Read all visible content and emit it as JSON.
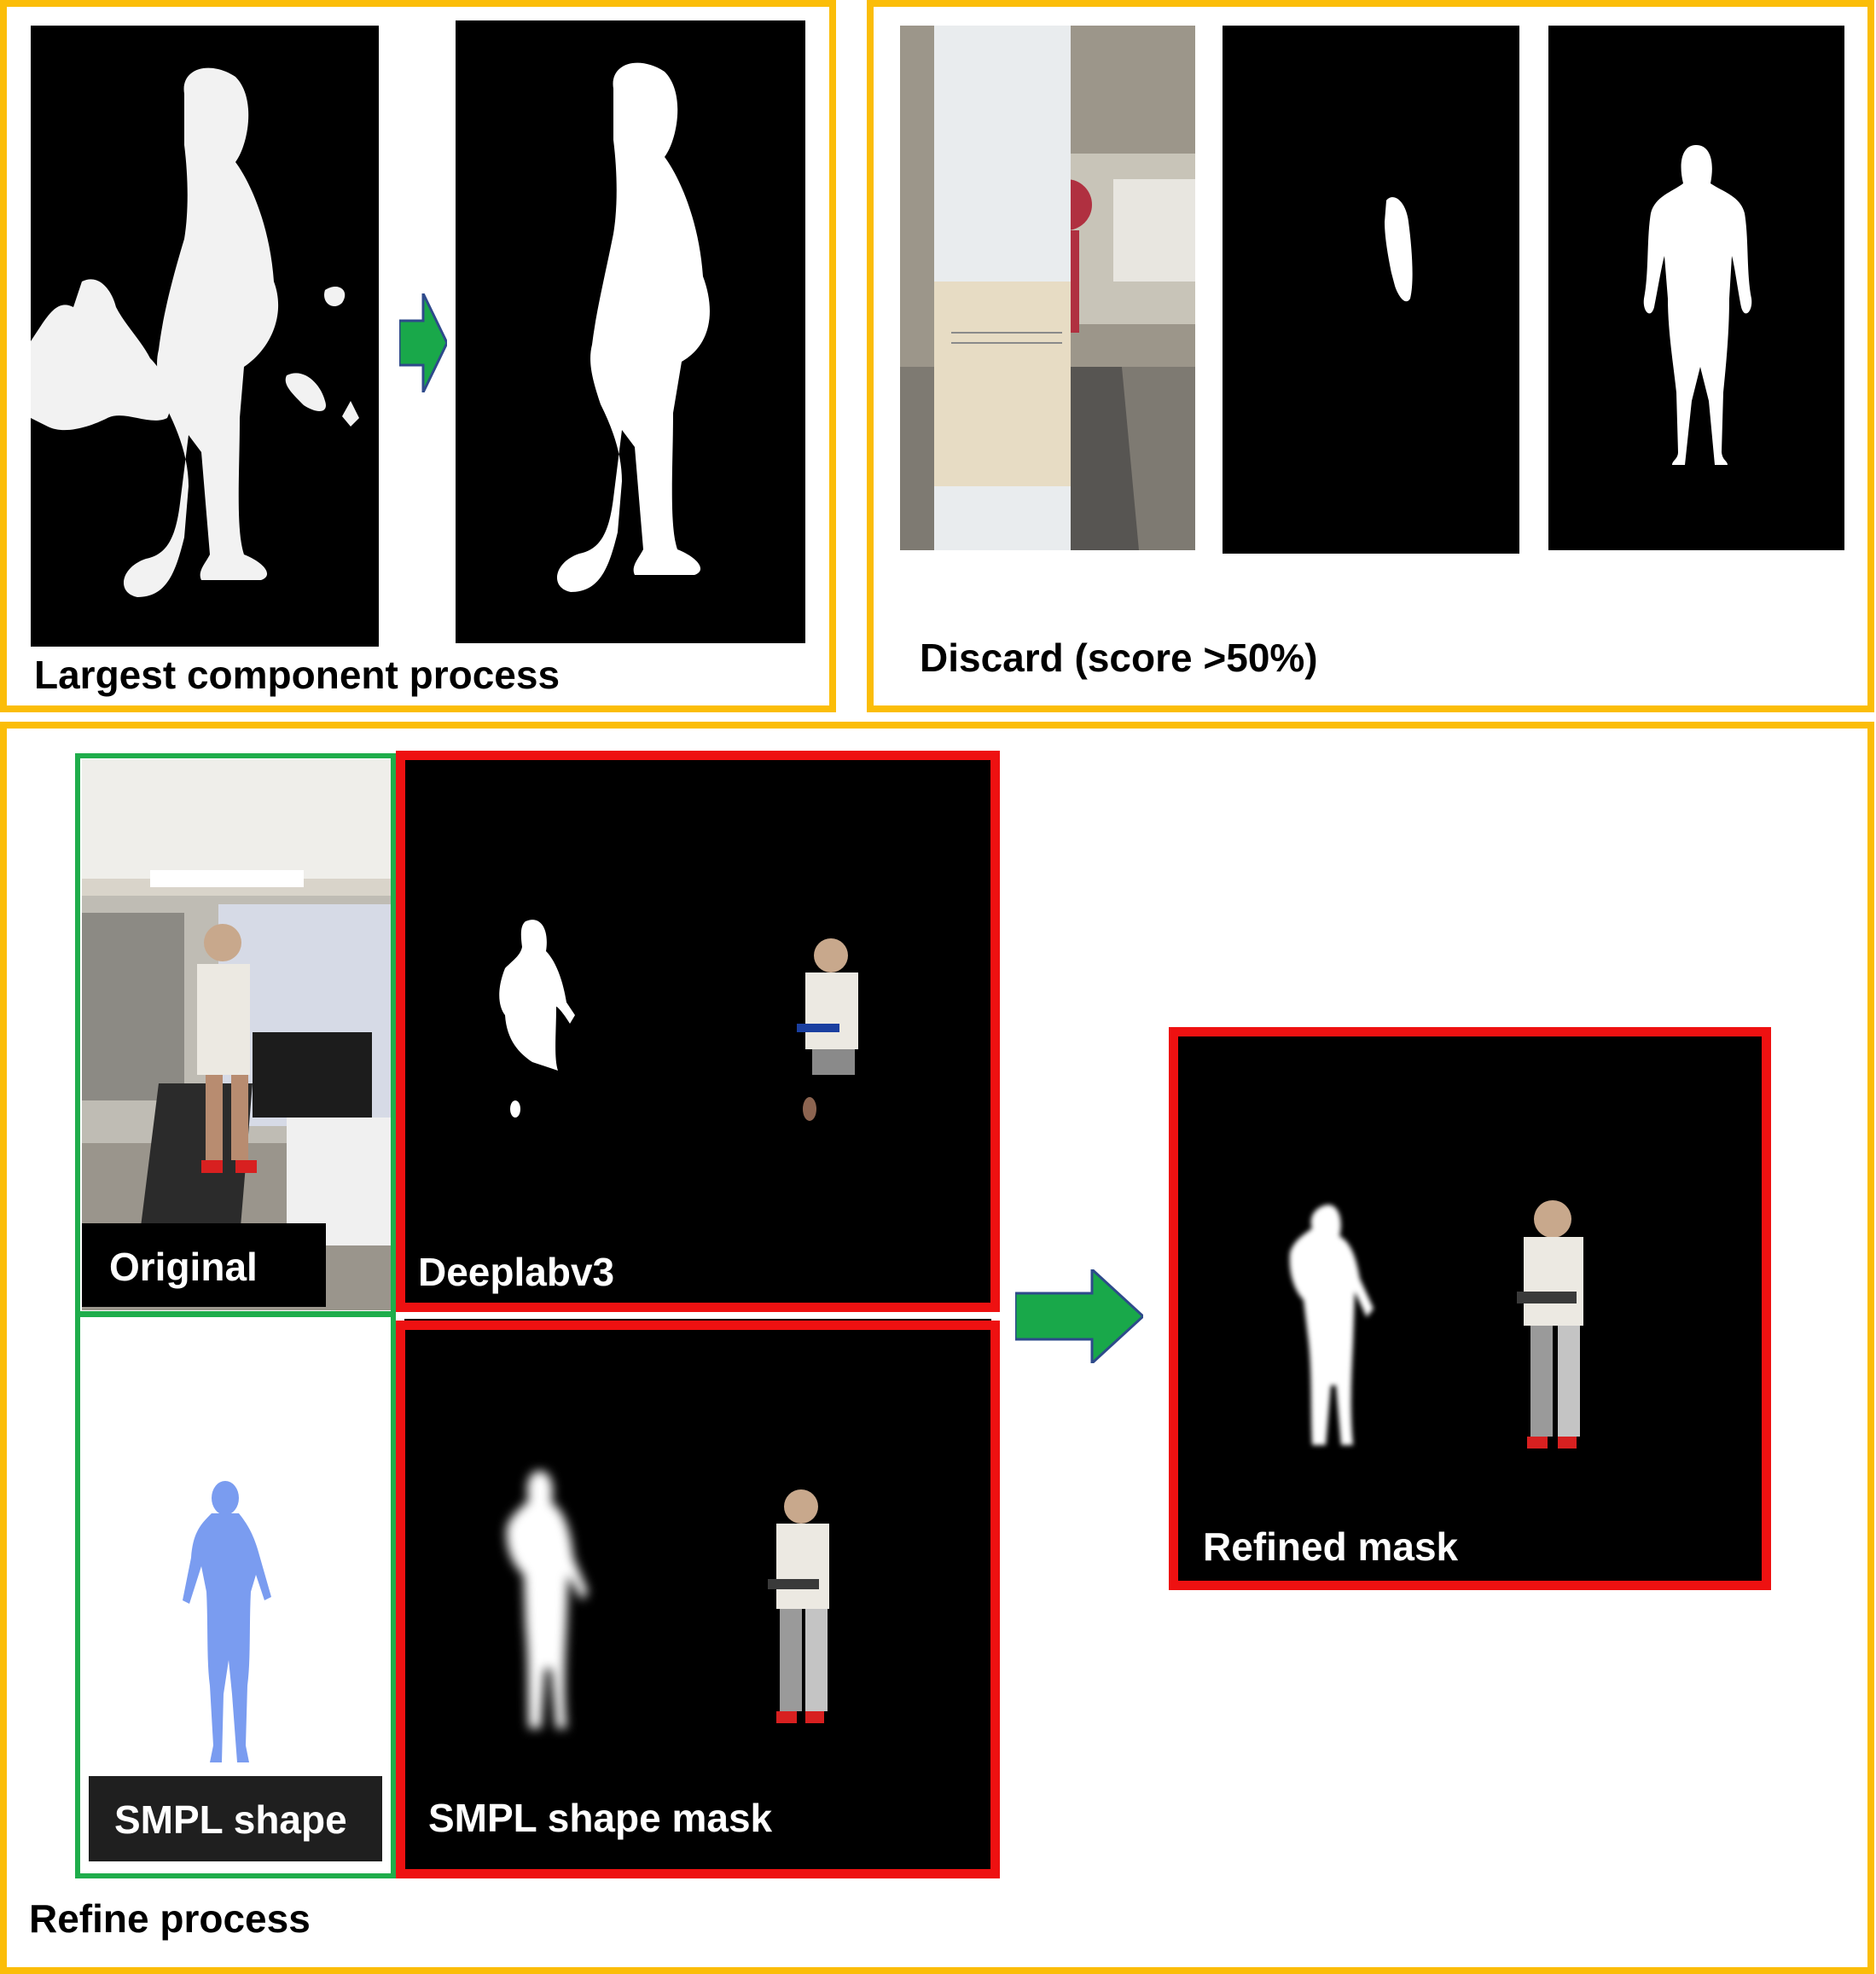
{
  "sections": {
    "largest_component": {
      "caption": "Largest component process"
    },
    "discard": {
      "caption": "Discard (score >50%)"
    },
    "refine": {
      "caption": "Refine process"
    }
  },
  "panels": {
    "original": "Original",
    "deeplab": "Deeplabv3",
    "smpl_shape": "SMPL shape",
    "smpl_mask": "SMPL shape mask",
    "refined": "Refined mask"
  },
  "colors": {
    "frame": "#fbbd08",
    "highlight_red": "#ee1111",
    "highlight_green": "#1fad4b",
    "arrow": "#19a84a",
    "mask": "#ffffff",
    "smpl_body": "#7a9cf0"
  },
  "icons": [
    "right-arrow-icon",
    "person-mask-icon",
    "person-photo-icon",
    "smpl-body-icon"
  ]
}
